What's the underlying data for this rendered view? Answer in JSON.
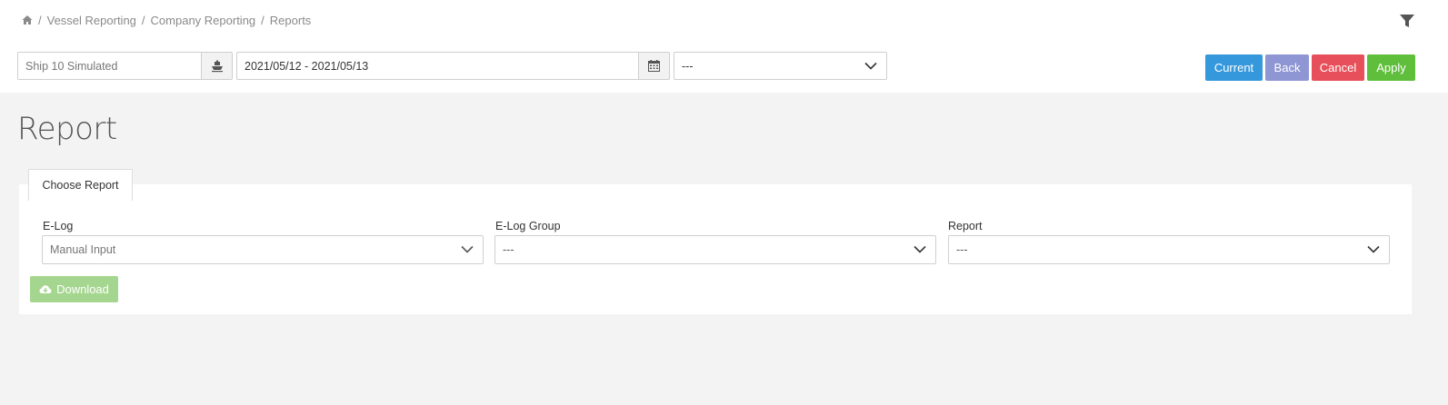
{
  "breadcrumb": {
    "items": [
      "Vessel Reporting",
      "Company Reporting",
      "Reports"
    ],
    "separator": "/"
  },
  "toolbar": {
    "ship_value": "Ship 10 Simulated",
    "date_range": "2021/05/12 - 2021/05/13",
    "select_value": "---",
    "buttons": {
      "current": "Current",
      "back": "Back",
      "cancel": "Cancel",
      "apply": "Apply"
    }
  },
  "page": {
    "title": "Report",
    "tab_label": "Choose Report"
  },
  "form": {
    "elog_label": "E-Log",
    "elog_value": "Manual Input",
    "group_label": "E-Log Group",
    "group_value": "---",
    "report_label": "Report",
    "report_value": "---",
    "download_label": "Download"
  },
  "icons": {
    "home": "home-icon",
    "filter": "filter-icon",
    "ship": "ship-icon",
    "calendar": "calendar-icon",
    "chevron": "chevron-down-icon",
    "download": "cloud-download-icon"
  },
  "colors": {
    "current": "#3598dc",
    "back": "#8e96d3",
    "cancel": "#e7505a",
    "apply": "#5fbe3b",
    "download": "#a5d68f"
  }
}
